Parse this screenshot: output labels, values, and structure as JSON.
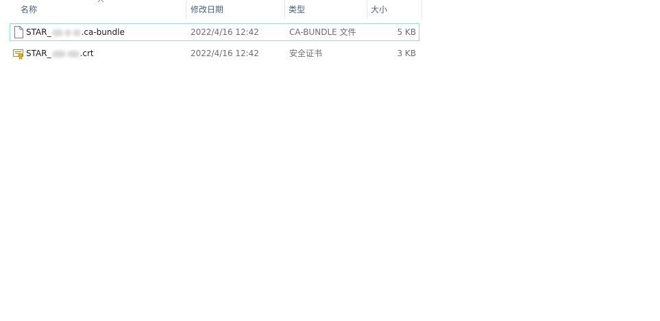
{
  "columns": {
    "name": "名称",
    "date": "修改日期",
    "type": "类型",
    "size": "大小"
  },
  "sort": {
    "column": "name",
    "direction": "ascending",
    "icon": "chevron-up-icon"
  },
  "files": [
    {
      "name_prefix": "STAR_",
      "name_suffix": ".ca-bundle",
      "modified": "2022/4/16 12:42",
      "type": "CA-BUNDLE 文件",
      "size": "5 KB",
      "icon": "generic-file-icon",
      "selected": true
    },
    {
      "name_prefix": "STAR_",
      "name_suffix": ".crt",
      "modified": "2022/4/16 12:42",
      "type": "安全证书",
      "size": "3 KB",
      "icon": "certificate-icon",
      "selected": false
    }
  ]
}
